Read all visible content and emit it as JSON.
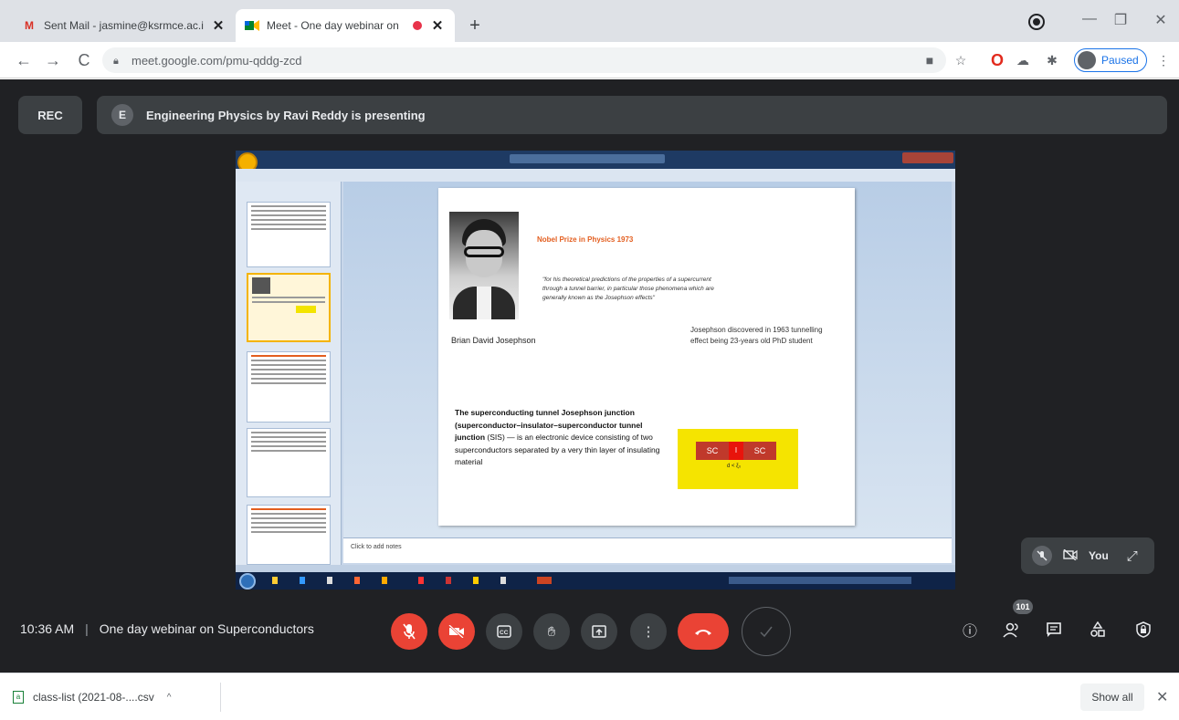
{
  "browser": {
    "tabs": [
      {
        "favicon": "gmail-icon",
        "title": "Sent Mail - jasmine@ksrmce.ac.i",
        "close": "✕"
      },
      {
        "favicon": "meet-icon",
        "title": "Meet - One day webinar on",
        "close": "✕"
      }
    ],
    "new_tab": "+",
    "window_controls": {
      "minimize": "—",
      "maximize": "❐",
      "close": "✕"
    },
    "url": "meet.google.com/pmu-qddg-zcd",
    "profile_status": "Paused",
    "nav": {
      "back": "←",
      "forward": "→",
      "reload": "C"
    }
  },
  "meet": {
    "rec_label": "REC",
    "presenter_initial": "E",
    "presenting_text": "Engineering Physics by Ravi Reddy is presenting",
    "time": "10:36 AM",
    "meeting_title": "One day webinar on Superconductors",
    "separator": "|",
    "self_view_label": "You",
    "participant_count": "101",
    "colors": {
      "red": "#ea4335",
      "background": "#202124",
      "surface": "#3c4043"
    }
  },
  "slide": {
    "title": "Nobel Prize in Physics 1973",
    "quote": "\"for his theoretical predictions of the properties of a supercurrent through a tunnel barrier, in particular those phenomena which are generally known as the Josephson effects\"",
    "caption": "Brian David Josephson",
    "side_text": "Josephson discovered in 1963 tunnelling effect being 23-years old PhD student",
    "body_bold": "The superconducting tunnel Josephson junction (superconductor–insulator–superconductor tunnel junction",
    "body_rest": " (SIS) — is an electronic device consisting of two superconductors separated by a very thin layer of insulating material",
    "sis_left": "SC",
    "sis_mid": "I",
    "sis_right": "SC",
    "sis_arrow": "d < ξ₀",
    "notes_placeholder": "Click to add notes"
  },
  "downloads": {
    "file": "class-list (2021-08-....csv",
    "caret": "^",
    "show_all": "Show all",
    "close": "✕"
  }
}
